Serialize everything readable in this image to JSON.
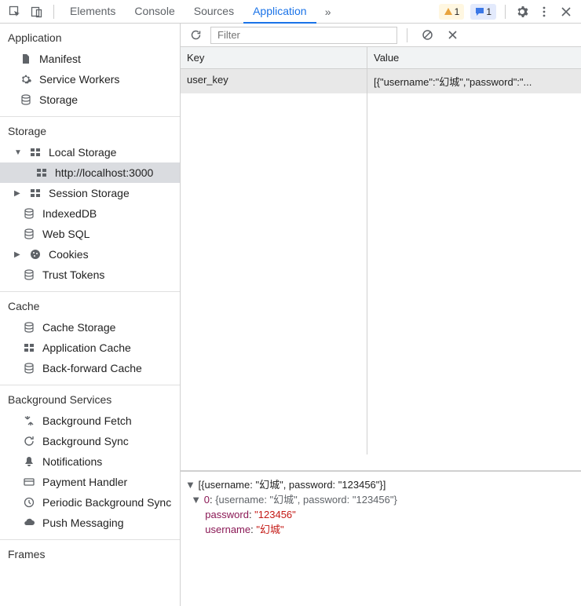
{
  "toolbar": {
    "tabs": [
      "Elements",
      "Console",
      "Sources",
      "Application"
    ],
    "activeTab": "Application",
    "warnings": 1,
    "messages": 1
  },
  "sidebar": {
    "applicationTitle": "Application",
    "applicationItems": [
      {
        "name": "manifest",
        "label": "Manifest"
      },
      {
        "name": "service-workers",
        "label": "Service Workers"
      },
      {
        "name": "storage",
        "label": "Storage"
      }
    ],
    "storageTitle": "Storage",
    "storage": {
      "localStorageLabel": "Local Storage",
      "localStorageChild": "http://localhost:3000",
      "sessionStorageLabel": "Session Storage",
      "items": [
        {
          "name": "indexeddb",
          "label": "IndexedDB"
        },
        {
          "name": "web-sql",
          "label": "Web SQL"
        }
      ],
      "cookiesLabel": "Cookies",
      "trustTokensLabel": "Trust Tokens"
    },
    "cacheTitle": "Cache",
    "cacheItems": [
      {
        "name": "cache-storage",
        "label": "Cache Storage"
      },
      {
        "name": "app-cache",
        "label": "Application Cache"
      },
      {
        "name": "bf-cache",
        "label": "Back-forward Cache"
      }
    ],
    "bgTitle": "Background Services",
    "bgItems": [
      {
        "name": "bg-fetch",
        "label": "Background Fetch"
      },
      {
        "name": "bg-sync",
        "label": "Background Sync"
      },
      {
        "name": "notifications",
        "label": "Notifications"
      },
      {
        "name": "payment-handler",
        "label": "Payment Handler"
      },
      {
        "name": "periodic-sync",
        "label": "Periodic Background Sync"
      },
      {
        "name": "push-messaging",
        "label": "Push Messaging"
      }
    ],
    "framesTitle": "Frames"
  },
  "filterbar": {
    "placeholder": "Filter"
  },
  "table": {
    "headers": {
      "key": "Key",
      "value": "Value"
    },
    "rows": [
      {
        "key": "user_key",
        "value": "[{\"username\":\"幻城\",\"password\":\"..."
      }
    ]
  },
  "preview": {
    "summary": "[{username: \"幻城\", password: \"123456\"}]",
    "index": "0",
    "indexSummary": "{username: \"幻城\", password: \"123456\"}",
    "entries": [
      {
        "key": "password",
        "value": "\"123456\""
      },
      {
        "key": "username",
        "value": "\"幻城\""
      }
    ]
  }
}
